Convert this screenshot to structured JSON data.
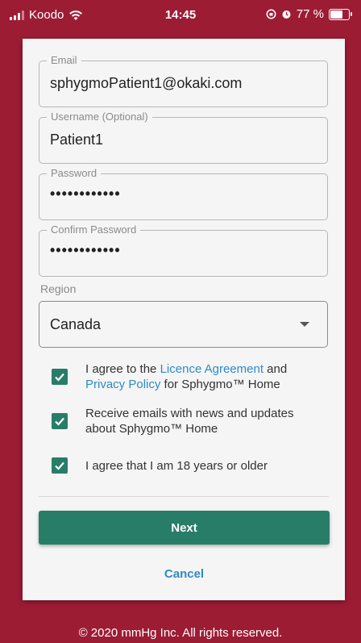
{
  "status_bar": {
    "carrier": "Koodo",
    "time": "14:45",
    "battery": "77 %",
    "battery_level": 0.77
  },
  "form": {
    "email": {
      "label": "Email",
      "value": "sphygmoPatient1@okaki.com"
    },
    "username": {
      "label": "Username (Optional)",
      "value": "Patient1"
    },
    "password": {
      "label": "Password",
      "value": "••••••••••••"
    },
    "confirm_password": {
      "label": "Confirm Password",
      "value": "••••••••••••"
    },
    "region": {
      "label": "Region",
      "value": "Canada"
    }
  },
  "agreements": {
    "licence": {
      "prefix": "I agree to the ",
      "licence_link": "Licence Agreement",
      "and": " and ",
      "privacy_link": "Privacy Policy",
      "suffix": " for Sphygmo™ Home",
      "checked": true
    },
    "emails": {
      "text": "Receive emails with news and updates about Sphygmo™ Home",
      "checked": true
    },
    "age": {
      "text": "I agree that I am 18 years or older",
      "checked": true
    }
  },
  "actions": {
    "next": "Next",
    "cancel": "Cancel"
  },
  "footer": "© 2020 mmHg Inc. All rights reserved.",
  "colors": {
    "background": "#9c1c34",
    "accent": "#287d68",
    "link": "#2f8ac6"
  }
}
